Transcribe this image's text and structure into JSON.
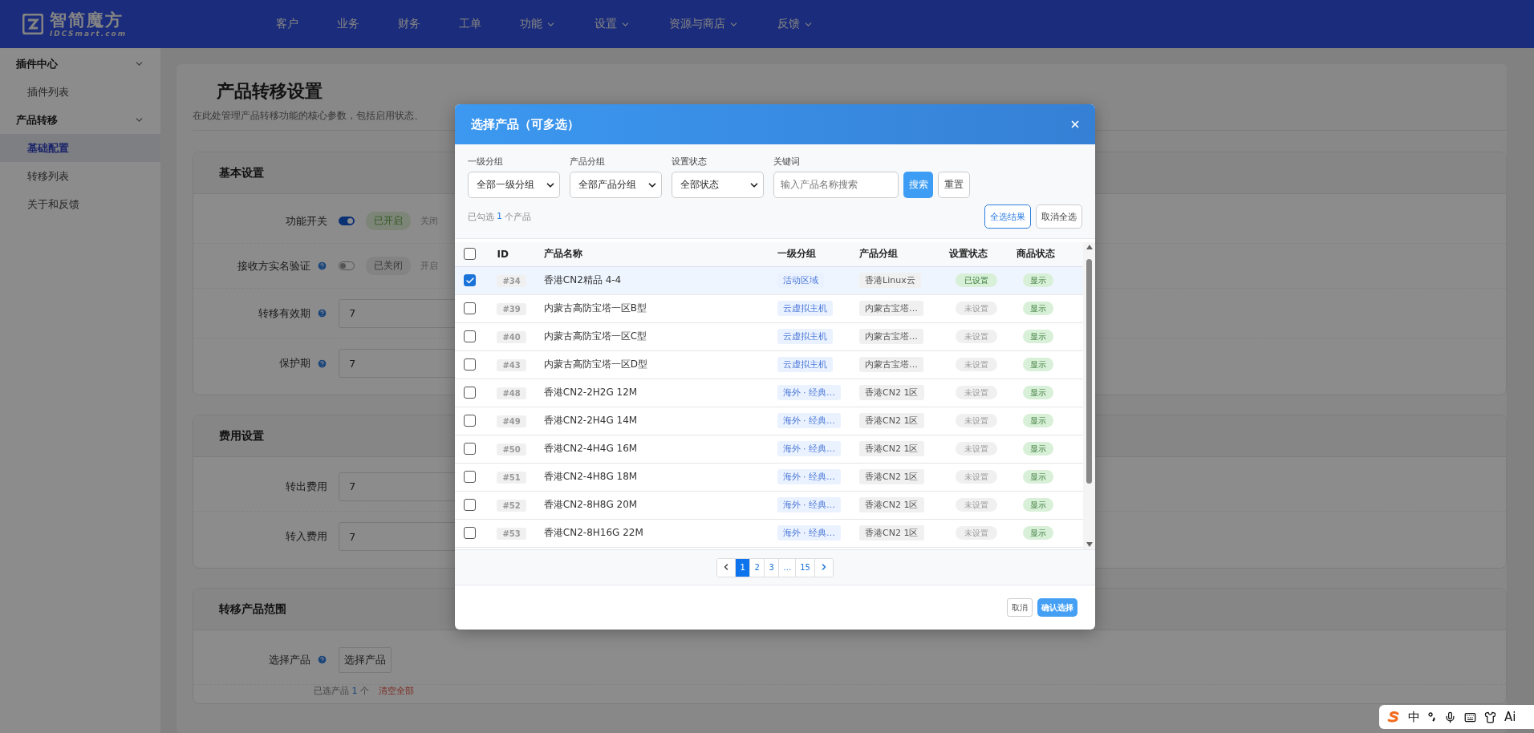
{
  "header": {
    "logo_title": "智简魔方",
    "logo_subtitle": "IDCSmart.com",
    "nav": [
      {
        "label": "客户",
        "dropdown": false
      },
      {
        "label": "业务",
        "dropdown": false
      },
      {
        "label": "财务",
        "dropdown": false
      },
      {
        "label": "工单",
        "dropdown": false
      },
      {
        "label": "功能",
        "dropdown": true
      },
      {
        "label": "设置",
        "dropdown": true
      },
      {
        "label": "资源与商店",
        "dropdown": true
      },
      {
        "label": "反馈",
        "dropdown": true
      }
    ]
  },
  "sidebar": {
    "groups": [
      {
        "label": "插件中心",
        "expanded": true,
        "children": [
          {
            "label": "插件列表",
            "selected": false
          }
        ]
      },
      {
        "label": "产品转移",
        "expanded": true,
        "children": [
          {
            "label": "基础配置",
            "selected": true
          },
          {
            "label": "转移列表",
            "selected": false
          },
          {
            "label": "关于和反馈",
            "selected": false
          }
        ]
      }
    ]
  },
  "page": {
    "title": "产品转移设置",
    "description": "在此处管理产品转移功能的核心参数，包括启用状态、",
    "sections": [
      {
        "title": "基本设置",
        "rows": [
          {
            "kind": "switch",
            "label": "功能开关",
            "on": true,
            "status": "已开启",
            "note": "关闭"
          },
          {
            "kind": "switch",
            "label": "接收方实名验证",
            "help": true,
            "on": false,
            "status": "已关闭",
            "note": "开启"
          },
          {
            "kind": "input",
            "label": "转移有效期",
            "help": true,
            "value": "7"
          },
          {
            "kind": "input",
            "label": "保护期",
            "help": true,
            "value": "7"
          }
        ]
      },
      {
        "title": "费用设置",
        "rows": [
          {
            "kind": "input",
            "label": "转出费用",
            "value": "7"
          },
          {
            "kind": "input",
            "label": "转入费用",
            "value": "7"
          }
        ]
      },
      {
        "title": "转移产品范围",
        "rows": [
          {
            "kind": "button",
            "label": "选择产品",
            "help": true,
            "button": "选择产品"
          }
        ]
      }
    ],
    "summary": {
      "prefix": "已选产品",
      "count": "1",
      "suffix": "个",
      "clear": "清空全部"
    }
  },
  "modal": {
    "title": "选择产品（可多选）",
    "filters": [
      {
        "kind": "select",
        "label": "一级分组",
        "value": "全部一级分组"
      },
      {
        "kind": "select",
        "label": "产品分组",
        "value": "全部产品分组"
      },
      {
        "kind": "select",
        "label": "设置状态",
        "value": "全部状态"
      },
      {
        "kind": "input",
        "label": "关键词",
        "placeholder": "输入产品名称搜索"
      }
    ],
    "search_button": "搜索",
    "reset_button": "重置",
    "picked": {
      "prefix": "已勾选",
      "count": "1",
      "suffix": "个产品"
    },
    "select_all_button": "全选结果",
    "deselect_button": "取消全选",
    "columns": [
      "ID",
      "产品名称",
      "一级分组",
      "产品分组",
      "设置状态",
      "商品状态"
    ],
    "header_checked": false,
    "rows": [
      {
        "checked": true,
        "id": "#34",
        "name": "香港CN2精品 4-4",
        "group": "活动区域",
        "product_group": "香港Linux云",
        "setting": "已设置",
        "configured": true,
        "status": "显示"
      },
      {
        "checked": false,
        "id": "#39",
        "name": "内蒙古高防宝塔一区B型",
        "group": "云虚拟主机",
        "product_group": "内蒙古宝塔…",
        "setting": "未设置",
        "configured": false,
        "status": "显示"
      },
      {
        "checked": false,
        "id": "#40",
        "name": "内蒙古高防宝塔一区C型",
        "group": "云虚拟主机",
        "product_group": "内蒙古宝塔…",
        "setting": "未设置",
        "configured": false,
        "status": "显示"
      },
      {
        "checked": false,
        "id": "#43",
        "name": "内蒙古高防宝塔一区D型",
        "group": "云虚拟主机",
        "product_group": "内蒙古宝塔…",
        "setting": "未设置",
        "configured": false,
        "status": "显示"
      },
      {
        "checked": false,
        "id": "#48",
        "name": "香港CN2-2H2G 12M",
        "group": "海外 · 经典…",
        "product_group": "香港CN2 1区",
        "setting": "未设置",
        "configured": false,
        "status": "显示"
      },
      {
        "checked": false,
        "id": "#49",
        "name": "香港CN2-2H4G 14M",
        "group": "海外 · 经典…",
        "product_group": "香港CN2 1区",
        "setting": "未设置",
        "configured": false,
        "status": "显示"
      },
      {
        "checked": false,
        "id": "#50",
        "name": "香港CN2-4H4G 16M",
        "group": "海外 · 经典…",
        "product_group": "香港CN2 1区",
        "setting": "未设置",
        "configured": false,
        "status": "显示"
      },
      {
        "checked": false,
        "id": "#51",
        "name": "香港CN2-4H8G 18M",
        "group": "海外 · 经典…",
        "product_group": "香港CN2 1区",
        "setting": "未设置",
        "configured": false,
        "status": "显示"
      },
      {
        "checked": false,
        "id": "#52",
        "name": "香港CN2-8H8G 20M",
        "group": "海外 · 经典…",
        "product_group": "香港CN2 1区",
        "setting": "未设置",
        "configured": false,
        "status": "显示"
      },
      {
        "checked": false,
        "id": "#53",
        "name": "香港CN2-8H16G 22M",
        "group": "海外 · 经典…",
        "product_group": "香港CN2 1区",
        "setting": "未设置",
        "configured": false,
        "status": "显示"
      }
    ],
    "pages": [
      {
        "label": "1",
        "selected": true
      },
      {
        "label": "2",
        "selected": false
      },
      {
        "label": "3",
        "selected": false
      },
      {
        "label": "…",
        "selected": false
      },
      {
        "label": "15",
        "selected": false
      }
    ],
    "cancel_button": "取消",
    "confirm_button": "确认选择"
  },
  "ime_toolbar": {
    "mode": "中",
    "ai": "Ai"
  }
}
